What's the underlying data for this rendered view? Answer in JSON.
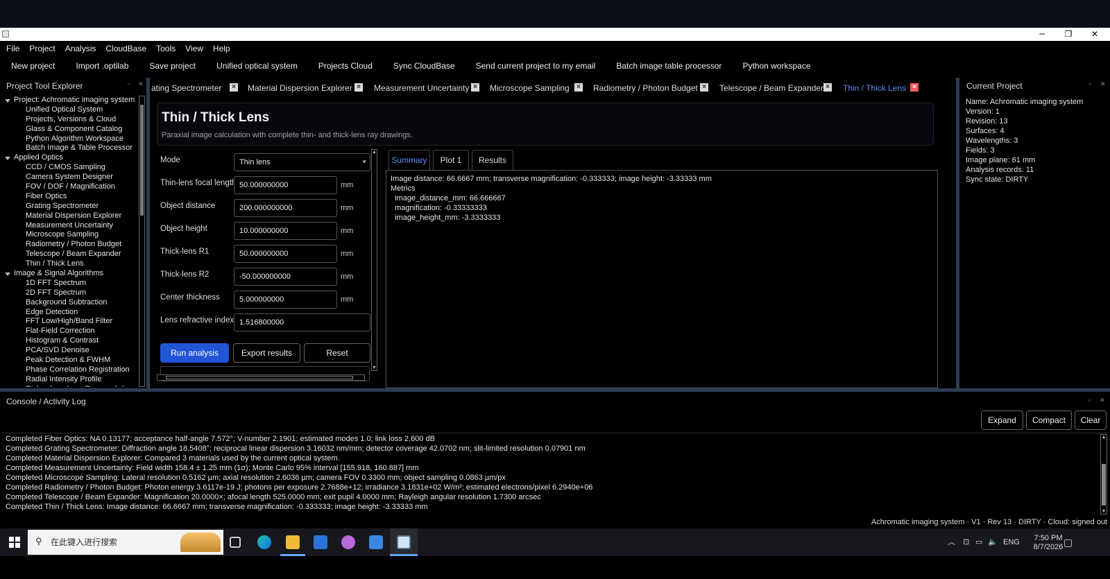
{
  "window": {
    "minimize": "─",
    "restore": "❐",
    "close": "✕"
  },
  "menu": [
    "File",
    "Project",
    "Analysis",
    "CloudBase",
    "Tools",
    "View",
    "Help"
  ],
  "toolbar": [
    "New project",
    "Import .optilab",
    "Save project",
    "Unified optical system",
    "Projects  Cloud",
    "Sync CloudBase",
    "Send current project to my email",
    "Batch image  table processor",
    "Python workspace"
  ],
  "explorer": {
    "title": "Project  Tool Explorer",
    "groups": [
      {
        "label": "Project: Achromatic imaging system",
        "items": [
          "Unified Optical System",
          "Projects, Versions & Cloud",
          "Glass & Component Catalog",
          "Python Algorithm Workspace",
          "Batch Image & Table Processor"
        ]
      },
      {
        "label": "Applied Optics",
        "items": [
          "CCD / CMOS Sampling",
          "Camera System Designer",
          "FOV / DOF / Magnification",
          "Fiber Optics",
          "Grating Spectrometer",
          "Material Dispersion Explorer",
          "Measurement Uncertainty",
          "Microscope Sampling",
          "Radiometry / Photon Budget",
          "Telescope / Beam Expander",
          "Thin / Thick Lens"
        ]
      },
      {
        "label": "Image & Signal Algorithms",
        "items": [
          "1D FFT Spectrum",
          "2D FFT Spectrum",
          "Background Subtraction",
          "Edge Detection",
          "FFT Low/High/Band Filter",
          "Flat-Field Correction",
          "Histogram & Contrast",
          "PCA/SVD Denoise",
          "Peak Detection & FWHM",
          "Phase Correlation Registration",
          "Radial Intensity Profile",
          "Richardson-Lucy Deconvolution"
        ]
      }
    ]
  },
  "tabs": [
    "rating Spectrometer",
    "Material Dispersion Explorer",
    "Measurement Uncertainty",
    "Microscope Sampling",
    "Radiometry / Photon Budget",
    "Telescope / Beam Expander",
    "Thin / Thick Lens"
  ],
  "page": {
    "title": "Thin / Thick Lens",
    "subtitle": "Paraxial image calculation with complete thin- and thick-lens ray drawings."
  },
  "form": {
    "mode_label": "Mode",
    "mode_value": "Thin lens",
    "fields": [
      {
        "label": "Thin-lens focal length",
        "value": "50.000000000",
        "unit": "mm"
      },
      {
        "label": "Object distance",
        "value": "200.000000000",
        "unit": "mm"
      },
      {
        "label": "Object height",
        "value": "10.000000000",
        "unit": "mm"
      },
      {
        "label": "Thick-lens R1",
        "value": "50.000000000",
        "unit": "mm"
      },
      {
        "label": "Thick-lens R2",
        "value": "-50.000000000",
        "unit": "mm"
      },
      {
        "label": "Center thickness",
        "value": "5.000000000",
        "unit": "mm"
      },
      {
        "label": "Lens refractive index",
        "value": "1.516800000",
        "unit": ""
      }
    ],
    "run": "Run analysis",
    "export": "Export results",
    "reset": "Reset"
  },
  "output": {
    "tabs": [
      "Summary",
      "Plot 1",
      "Results"
    ],
    "lines": [
      "Image distance: 66.6667 mm; transverse magnification: -0.333333; image height: -3.33333 mm",
      "",
      "Metrics",
      "  image_distance_mm: 66.666667",
      "  magnification: -0.33333333",
      "  image_height_mm: -3.3333333"
    ]
  },
  "current_project": {
    "title": "Current Project",
    "lines": [
      "Name: Achromatic imaging system",
      "Version: 1",
      "Revision: 13",
      "Surfaces: 4",
      "Wavelengths: 3",
      "Fields: 3",
      "Image plane: 61 mm",
      "Analysis records: 11",
      "Sync state: DIRTY"
    ]
  },
  "console": {
    "title": "Console / Activity Log",
    "buttons": [
      "Expand",
      "Compact",
      "Clear"
    ],
    "lines": [
      "Completed Fiber Optics: NA 0.13177; acceptance half-angle 7.572°; V-number 2.1901; estimated modes 1.0; link loss 2.600 dB",
      "Completed Grating Spectrometer: Diffraction angle 18.5408°; reciprocal linear dispersion 3.16032 nm/mm; detector coverage 42.0702 nm; slit-limited resolution 0.07901 nm",
      "Completed Material Dispersion Explorer: Compared 3 materials used by the current optical system.",
      "Completed Measurement Uncertainty: Field width 158.4 ± 1.25 mm (1σ); Monte Carlo 95% interval [155.918, 160.887] mm",
      "Completed Microscope Sampling: Lateral resolution 0.5162 µm; axial resolution 2.6036 µm; camera FOV 0.3300 mm; object sampling 0.0863 µm/px",
      "Completed Radiometry / Photon Budget: Photon energy 3.6117e-19 J; photons per exposure 2.7688e+12; irradiance 3.1831e+02 W/m²; estimated electrons/pixel 6.2940e+06",
      "Completed Telescope / Beam Expander: Magnification 20.0000×; afocal length 525.0000 mm; exit pupil 4.0000 mm; Rayleigh angular resolution 1.7300 arcsec",
      "Completed Thin / Thick Lens: Image distance: 66.6667 mm; transverse magnification: -0.333333; image height: -3.33333 mm"
    ]
  },
  "status": "Achromatic imaging system · V1 · Rev 13 · DIRTY · Cloud: signed out",
  "taskbar": {
    "search": "在此键入进行搜索",
    "lang": "ENG",
    "time": "7:50 PM",
    "date": "8/7/2026"
  },
  "colors": {
    "accent": "#2155d6",
    "active_tab": "#5b8ef0",
    "close_active": "#ff5a5a"
  }
}
